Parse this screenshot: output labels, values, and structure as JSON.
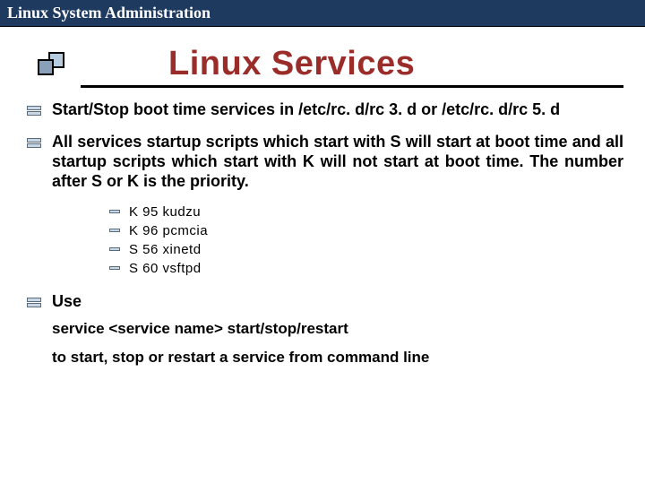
{
  "header": {
    "title": "Linux System Administration"
  },
  "slide": {
    "title": "Linux Services",
    "bullets": [
      {
        "text": "Start/Stop boot time services in /etc/rc. d/rc 3. d or /etc/rc. d/rc 5. d"
      },
      {
        "text": "All services startup scripts which start with S will start at boot time and all startup scripts which start with K will not start at boot time. The number after S or K is the priority."
      }
    ],
    "sublist": [
      "K 95 kudzu",
      "K 96 pcmcia",
      "S 56 xinetd",
      "S 60 vsftpd"
    ],
    "use": {
      "label": "Use",
      "command": "service <service name> start/stop/restart",
      "desc": "to start, stop or restart a service from command line"
    }
  }
}
